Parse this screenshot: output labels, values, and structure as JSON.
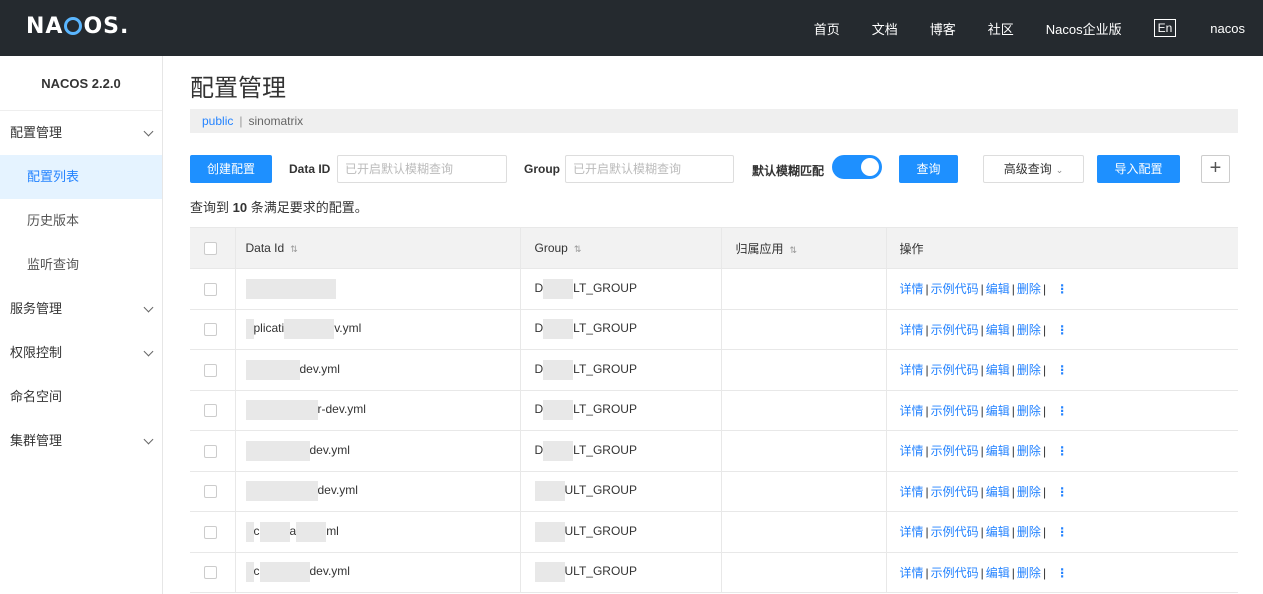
{
  "header": {
    "logo": "NACOS.",
    "nav": [
      "首页",
      "文档",
      "博客",
      "社区",
      "Nacos企业版"
    ],
    "lang": "En",
    "user": "nacos"
  },
  "sidebar": {
    "version": "NACOS 2.2.0",
    "items": [
      {
        "label": "配置管理",
        "has_chevron": true
      },
      {
        "label": "配置列表",
        "sub": true,
        "active": true
      },
      {
        "label": "历史版本",
        "sub": true
      },
      {
        "label": "监听查询",
        "sub": true
      },
      {
        "label": "服务管理",
        "has_chevron": true
      },
      {
        "label": "权限控制",
        "has_chevron": true
      },
      {
        "label": "命名空间"
      },
      {
        "label": "集群管理",
        "has_chevron": true
      }
    ]
  },
  "main": {
    "title": "配置管理",
    "breadcrumb": {
      "namespace": "public",
      "separator": "|",
      "name": "sinomatrix"
    },
    "toolbar": {
      "create_label": "创建配置",
      "dataid_label": "Data ID",
      "dataid_placeholder": "已开启默认模糊查询",
      "group_label": "Group",
      "group_placeholder": "已开启默认模糊查询",
      "fuzzy_label": "默认模糊匹配",
      "fuzzy_on": true,
      "query_label": "查询",
      "advanced_label": "高级查询",
      "import_label": "导入配置",
      "plus_label": "+"
    },
    "summary": {
      "prefix": "查询到 ",
      "count": "10",
      "suffix": " 条满足要求的配置。"
    },
    "table": {
      "columns": [
        "Data Id",
        "Group",
        "归属应用",
        "操作"
      ],
      "ops": [
        "详情",
        "示例代码",
        "编辑",
        "删除"
      ],
      "rows": [
        {
          "data_id": "",
          "group": "D",
          "group_tail": "LT_GROUP",
          "app": ""
        },
        {
          "data_id": "plicati",
          "data_id_tail": "v.yml",
          "group": "D",
          "group_tail": "LT_GROUP",
          "app": ""
        },
        {
          "data_id": "",
          "data_id_tail": "dev.yml",
          "group": "D",
          "group_tail": "LT_GROUP",
          "app": ""
        },
        {
          "data_id": "",
          "data_id_tail": "r-dev.yml",
          "group": "D",
          "group_tail": "LT_GROUP",
          "app": ""
        },
        {
          "data_id": "",
          "data_id_tail": "dev.yml",
          "group": "D",
          "group_tail": "LT_GROUP",
          "app": ""
        },
        {
          "data_id": "",
          "data_id_tail": "dev.yml",
          "group": "",
          "group_tail": "ULT_GROUP",
          "app": ""
        },
        {
          "data_id": "c",
          "data_id_mid": "a",
          "data_id_tail": "ml",
          "group": "",
          "group_tail": "ULT_GROUP",
          "app": ""
        },
        {
          "data_id": "c",
          "data_id_tail": "dev.yml",
          "group": "",
          "group_tail": "ULT_GROUP",
          "app": ""
        }
      ]
    }
  }
}
